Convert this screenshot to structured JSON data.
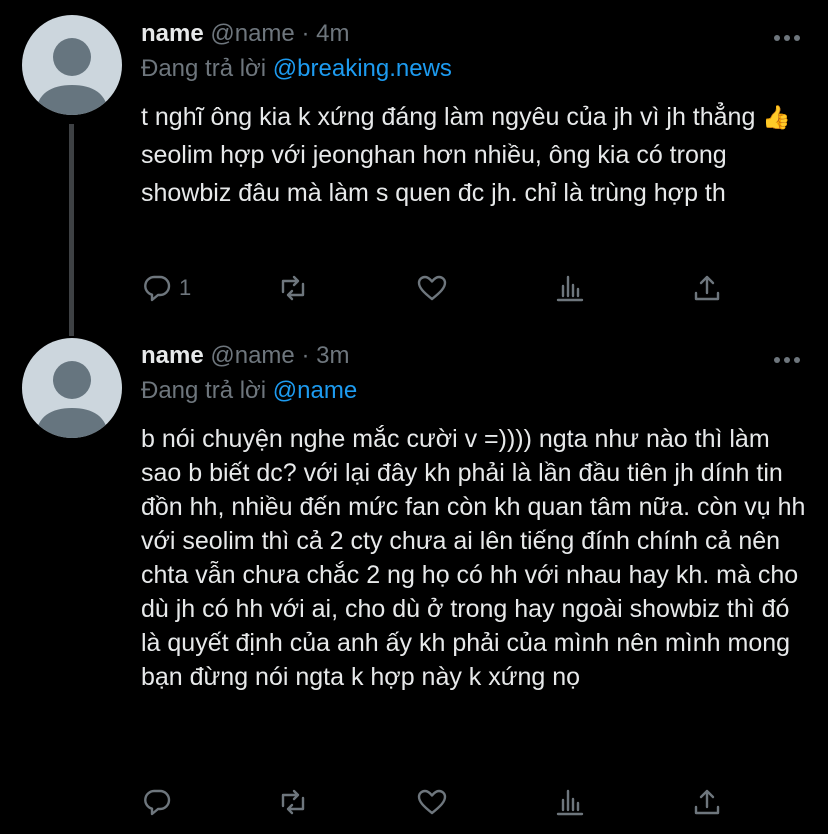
{
  "tweets": [
    {
      "name": "name",
      "handle": "@name",
      "dot": "·",
      "time": "4m",
      "reply_prefix": "Đang trả lời",
      "reply_to": "@breaking.news",
      "text_a": "t nghĩ ông kia k xứng đáng làm ngyêu của jh vì jh thẳng",
      "emoji": "👍",
      "text_b": " seolim hợp với jeonghan hơn nhiều, ông kia có trong showbiz đâu mà làm s quen đc jh. chỉ là trùng hợp th",
      "reply_count": "1"
    },
    {
      "name": "name",
      "handle": "@name",
      "dot": "·",
      "time": "3m",
      "reply_prefix": "Đang trả lời",
      "reply_to": "@name",
      "text": "b nói chuyện nghe mắc cười v =)))) ngta như nào thì làm sao b biết dc? với lại đây kh phải là lần đầu tiên jh dính tin đồn hh, nhiều đến mức fan còn kh quan tâm nữa. còn vụ hh với seolim thì cả 2 cty chưa ai lên tiếng đính chính cả nên chta vẫn chưa chắc 2 ng họ có hh với nhau hay kh. mà cho dù jh có hh với ai, cho dù ở trong hay ngoài showbiz thì đó là quyết định của anh ấy kh phải của mình nên mình mong bạn đừng nói ngta k hợp này k xứng nọ",
      "reply_count": ""
    }
  ],
  "icons": [
    "avatar",
    "more-icon",
    "reply-icon",
    "retweet-icon",
    "like-icon",
    "analytics-icon",
    "share-icon"
  ],
  "colors": {
    "background": "#000000",
    "link": "#1d9bf0",
    "muted": "#6e767d",
    "text": "#e7e9ea",
    "thread_line": "#3e4144"
  }
}
